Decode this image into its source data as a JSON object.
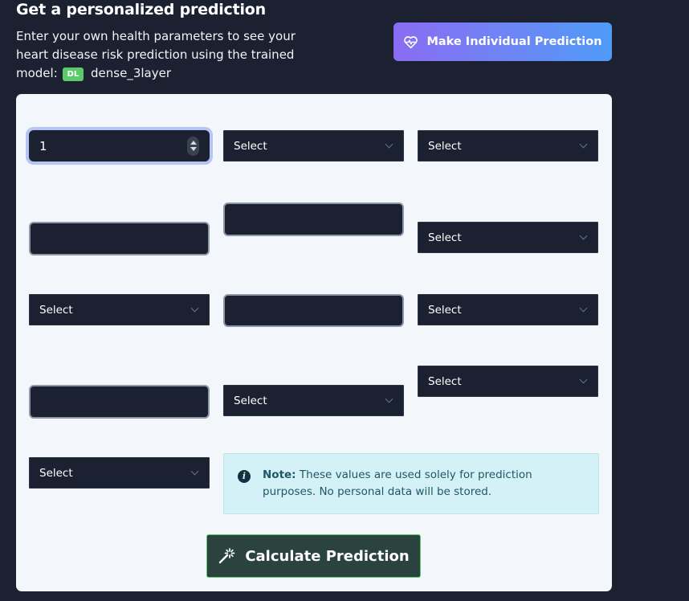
{
  "header": {
    "title": "Get a personalized prediction",
    "description": "Enter your own health parameters to see your heart disease risk prediction using the trained model:",
    "model_badge": "DL",
    "model_name": "dense_3layer",
    "make_prediction_label": "Make Individual Prediction"
  },
  "form": {
    "age_value": "1",
    "select_placeholder": "Select"
  },
  "note": {
    "label": "Note:",
    "text": "These values are used solely for prediction purposes. No personal data will be stored."
  },
  "calculate_label": "Calculate Prediction",
  "colors": {
    "accent_green": "#5cc96a",
    "button_gradient_start": "#8a6cf2",
    "button_gradient_end": "#4f9bf7",
    "field_bg": "#1b2130"
  }
}
